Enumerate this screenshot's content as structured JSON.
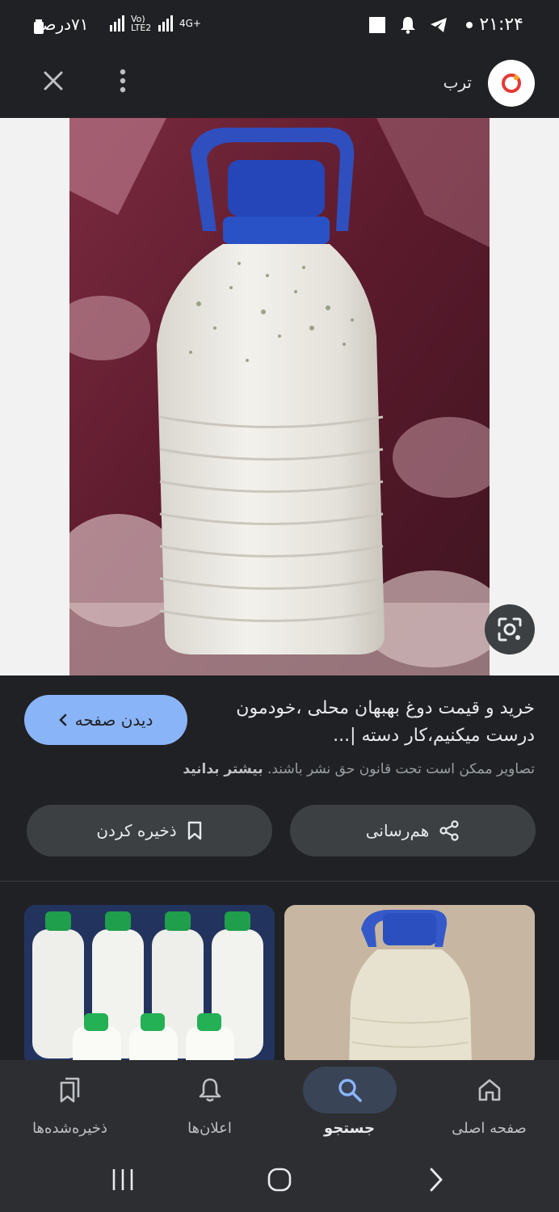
{
  "status_bar": {
    "time": "۲۱:۲۴",
    "battery_text": "۷۱درصد",
    "network": "4G+",
    "volte": "Vo) LTE2"
  },
  "top_bar": {
    "site_name": "ترب"
  },
  "result": {
    "title": "خرید و قیمت دوغ بهبهان محلی ،خودمون درست میکنیم،کار دسته |...",
    "visit_label": "دیدن صفحه",
    "copyright_text": "تصاویر ممکن است تحت قانون حق نشر باشند.",
    "learn_more": "بیشتر بدانید"
  },
  "actions": {
    "share_label": "هم‌رسانی",
    "save_label": "ذخیره کردن"
  },
  "bottom_nav": {
    "items": [
      {
        "label": "صفحه اصلی",
        "icon": "home-icon"
      },
      {
        "label": "جستجو",
        "icon": "search-icon",
        "active": true
      },
      {
        "label": "اعلان‌ها",
        "icon": "bell-icon"
      },
      {
        "label": "ذخیره‌شده‌ها",
        "icon": "saved-icon"
      }
    ]
  },
  "colors": {
    "background": "#202124",
    "accent": "#8ab4f8",
    "button_bg": "#3c4043",
    "nav_bg": "#2d2e31",
    "active_nav": "#394457"
  }
}
